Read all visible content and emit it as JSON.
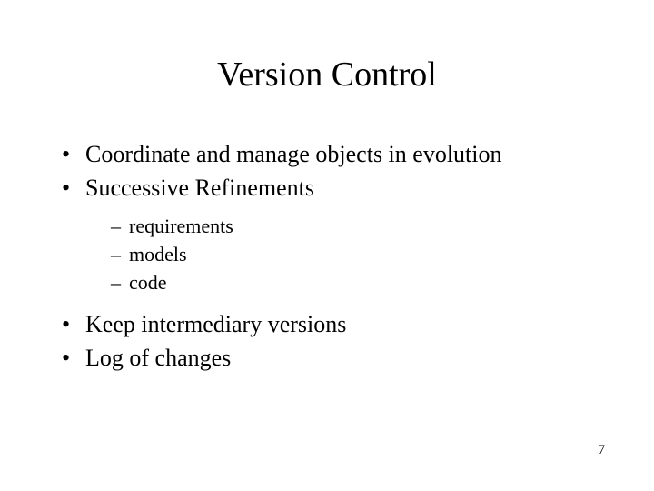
{
  "title": "Version Control",
  "bullets": {
    "b0": "Coordinate and manage objects in evolution",
    "b1": "Successive Refinements",
    "b1_sub": {
      "s0": "requirements",
      "s1": "models",
      "s2": "code"
    },
    "b2": "Keep intermediary versions",
    "b3": "Log of changes"
  },
  "page_number": "7"
}
